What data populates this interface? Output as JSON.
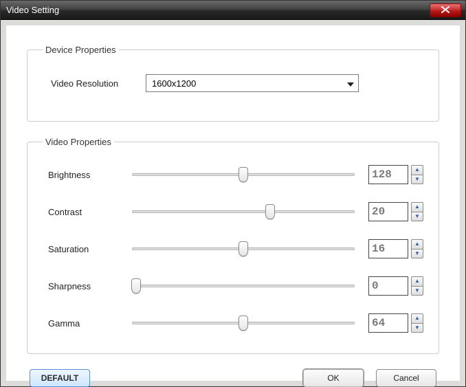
{
  "window": {
    "title": "Video Setting"
  },
  "device": {
    "legend": "Device Properties",
    "resolution_label": "Video Resolution",
    "resolution_value": "1600x1200"
  },
  "video": {
    "legend": "Video Properties",
    "props": [
      {
        "label": "Brightness",
        "value": "128",
        "percent": 50
      },
      {
        "label": "Contrast",
        "value": "20",
        "percent": 62
      },
      {
        "label": "Saturation",
        "value": "16",
        "percent": 50
      },
      {
        "label": "Sharpness",
        "value": "0",
        "percent": 2
      },
      {
        "label": "Gamma",
        "value": "64",
        "percent": 50
      }
    ]
  },
  "buttons": {
    "default": "DEFAULT",
    "ok": "OK",
    "cancel": "Cancel"
  }
}
